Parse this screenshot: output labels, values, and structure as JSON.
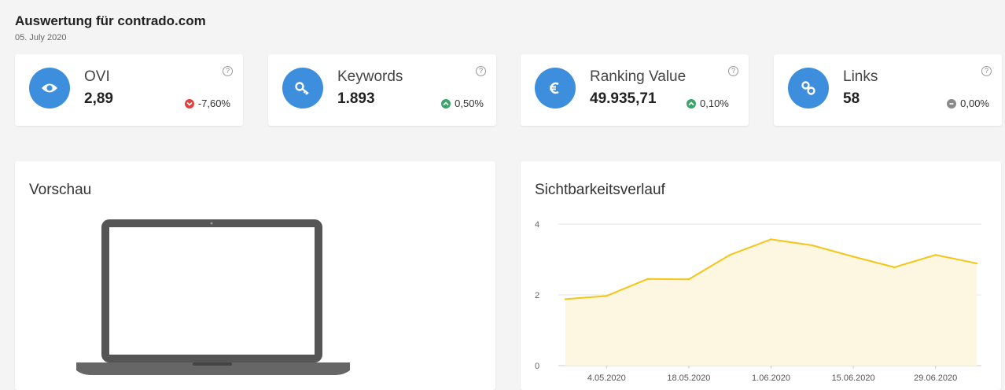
{
  "header": {
    "title": "Auswertung für contrado.com",
    "date": "05. July 2020"
  },
  "kpis": [
    {
      "label": "OVI",
      "value": "2,89",
      "change": "-7,60%",
      "trend": "down",
      "icon": "eye-icon",
      "help": "?"
    },
    {
      "label": "Keywords",
      "value": "1.893",
      "change": "0,50%",
      "trend": "up",
      "icon": "key-icon",
      "help": "?"
    },
    {
      "label": "Ranking Value",
      "value": "49.935,71",
      "change": "0,10%",
      "trend": "up",
      "icon": "euro-icon",
      "help": "?"
    },
    {
      "label": "Links",
      "value": "58",
      "change": "0,00%",
      "trend": "neutral",
      "icon": "link-icon",
      "help": "?"
    }
  ],
  "colors": {
    "icon_bg": "#3e8ede",
    "down": "#e0433c",
    "up": "#3aa46b",
    "neutral": "#8a8a8a",
    "line": "#f5c518",
    "area": "#fdf6e0"
  },
  "preview": {
    "title": "Vorschau"
  },
  "visibility": {
    "title": "Sichtbarkeitsverlauf",
    "chart_data": {
      "type": "area",
      "x": [
        "27.04.2020",
        "4.05.2020",
        "11.05.2020",
        "18.05.2020",
        "25.05.2020",
        "1.06.2020",
        "8.06.2020",
        "15.06.2020",
        "22.06.2020",
        "29.06.2020",
        "05.07.2020"
      ],
      "values": [
        1.88,
        1.97,
        2.45,
        2.44,
        3.13,
        3.57,
        3.4,
        3.08,
        2.78,
        3.13,
        2.89
      ],
      "tick_labels": [
        "4.05.2020",
        "18.05.2020",
        "1.06.2020",
        "15.06.2020",
        "29.06.2020"
      ],
      "y_ticks": [
        "0",
        "2",
        "4"
      ],
      "ylim": [
        0,
        4
      ],
      "grid": true
    }
  }
}
